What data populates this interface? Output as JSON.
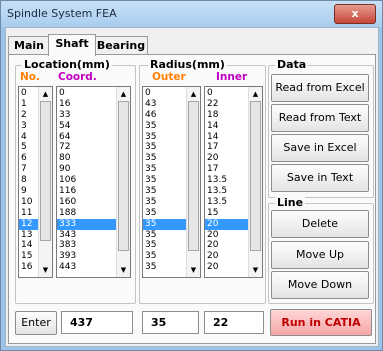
{
  "window": {
    "title": "Spindle System FEA",
    "close_glyph": "x"
  },
  "tabs": [
    {
      "label": "Main"
    },
    {
      "label": "Shaft"
    },
    {
      "label": "Bearing"
    }
  ],
  "location": {
    "group_title": "Location(mm)",
    "no_header": "No.",
    "coord_header": "Coord.",
    "no_values": [
      "0",
      "1",
      "2",
      "3",
      "4",
      "5",
      "6",
      "7",
      "8",
      "9",
      "10",
      "11",
      "12",
      "13",
      "14",
      "15",
      "16"
    ],
    "coord_values": [
      "0",
      "16",
      "33",
      "54",
      "64",
      "72",
      "80",
      "90",
      "106",
      "116",
      "160",
      "188",
      "333",
      "343",
      "383",
      "393",
      "443"
    ],
    "selected_index": 12
  },
  "radius": {
    "group_title": "Radius(mm)",
    "outer_header": "Outer",
    "inner_header": "Inner",
    "outer_values": [
      "0",
      "43",
      "46",
      "35",
      "35",
      "35",
      "35",
      "35",
      "35",
      "35",
      "35",
      "35",
      "35",
      "35",
      "35",
      "35",
      "35"
    ],
    "inner_values": [
      "0",
      "22",
      "18",
      "14",
      "14",
      "17",
      "20",
      "17",
      "13.5",
      "13.5",
      "13.5",
      "15",
      "20",
      "20",
      "20",
      "20",
      "20"
    ],
    "selected_index": 12
  },
  "entry": {
    "enter_label": "Enter",
    "coord_value": "437",
    "outer_value": "35",
    "inner_value": "22"
  },
  "data_group": {
    "title": "Data",
    "buttons": [
      "Read from Excel",
      "Read from Text",
      "Save in Excel",
      "Save in Text"
    ]
  },
  "line_group": {
    "title": "Line",
    "buttons": [
      "Delete",
      "Move Up",
      "Move Down"
    ]
  },
  "run_button": "Run in CATIA",
  "colors": {
    "no_header": "#ff8000",
    "coord_header": "#c000c0",
    "outer_header": "#ff8000",
    "inner_header": "#c000c0",
    "run_text": "#c00000",
    "selection": "#3399ff"
  }
}
